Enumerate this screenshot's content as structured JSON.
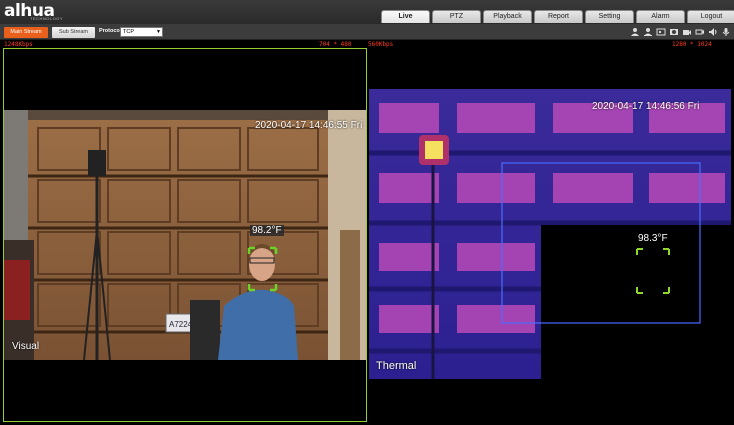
{
  "brand": {
    "logo_text": "alhua",
    "tagline": "TECHNOLOGY"
  },
  "nav": {
    "tabs": [
      {
        "label": "Live",
        "active": true
      },
      {
        "label": "PTZ"
      },
      {
        "label": "Playback"
      },
      {
        "label": "Report"
      },
      {
        "label": "Setting"
      },
      {
        "label": "Alarm"
      },
      {
        "label": "Logout"
      }
    ]
  },
  "toolbar": {
    "main_stream_label": "Main Stream",
    "sub_stream_label": "Sub Stream",
    "protocol_label": "Protocol",
    "protocol_value": "TCP",
    "icons": [
      "user-icon",
      "user-icon",
      "snapshot-icon",
      "photo-icon",
      "record-icon",
      "camera-icon",
      "speaker-icon",
      "microphone-icon"
    ]
  },
  "stream_info": {
    "left_bitrate": "1248Kbps",
    "left_resolution": "704 * 480",
    "right_bitrate": "560Kbps",
    "right_resolution": "1280 * 1024"
  },
  "visual": {
    "timestamp": "2020-04-17 14:46:55 Fri",
    "temperature": "98.2°F",
    "label": "Visual",
    "plate_text": "A7224E"
  },
  "thermal": {
    "timestamp": "2020-04-17 14:46:56 Fri",
    "temperature": "98.3°F",
    "label": "Thermal"
  },
  "colors": {
    "accent": "#e8601c",
    "stream_info": "#ff3b1f",
    "face_box": "#6fd02a",
    "thermal_roi": "#4a6cff"
  }
}
